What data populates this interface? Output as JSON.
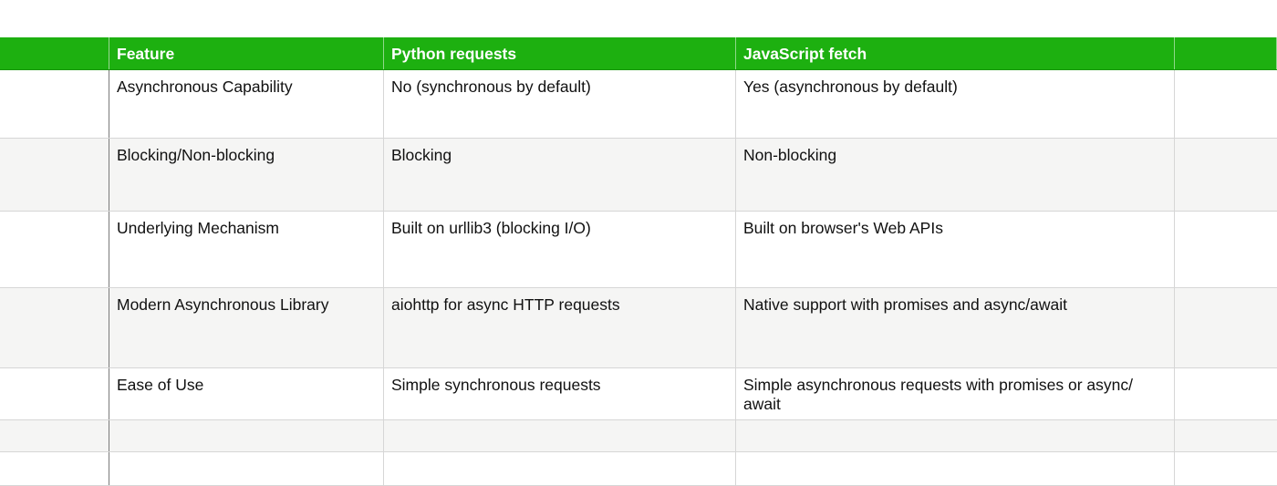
{
  "table": {
    "headers": [
      "",
      "Feature",
      "Python requests",
      "JavaScript fetch",
      ""
    ],
    "rows": [
      [
        "",
        "Asynchronous Capability",
        "No (synchronous by default)",
        "Yes (asynchronous by default)",
        ""
      ],
      [
        "",
        "Blocking/Non-blocking",
        "Blocking",
        "Non-blocking",
        ""
      ],
      [
        "",
        "Underlying Mechanism",
        "Built on urllib3 (blocking I/O)",
        "Built on browser's Web APIs",
        ""
      ],
      [
        "",
        "Modern Asynchronous Library",
        "aiohttp for async HTTP requests",
        "Native support with promises and async/await",
        ""
      ],
      [
        "",
        "Ease of Use",
        "Simple synchronous requests",
        "Simple asynchronous requests with promises or async/ await",
        ""
      ],
      [
        "",
        "",
        "",
        "",
        ""
      ],
      [
        "",
        "",
        "",
        "",
        ""
      ]
    ]
  },
  "colors": {
    "header_bg": "#1db010",
    "header_text": "#ffffff",
    "alt_row_bg": "#f5f5f4",
    "grid_line": "#d6d6d6"
  }
}
